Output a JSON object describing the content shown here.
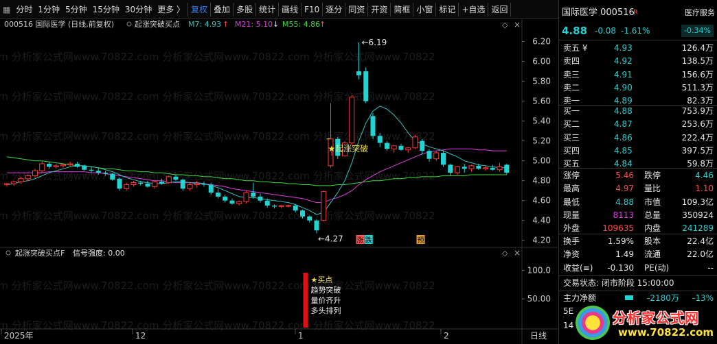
{
  "toolbar": {
    "periods": [
      "分时",
      "1分钟",
      "5分钟",
      "15分钟",
      "30分钟",
      "更多 〉"
    ],
    "tools": [
      "复权",
      "叠加",
      "多股",
      "统计",
      "画线",
      "F10",
      "逐分",
      "同资",
      "开资",
      "简框",
      "小窗",
      "标记",
      "+自选",
      "返回"
    ]
  },
  "chart": {
    "header": {
      "code": "000516",
      "name": "国际医学",
      "mode": "(日线,前复权)",
      "indicator": "起涨突破买点",
      "ma7": "M7: 4.93",
      "ma21": "M21: 5.10",
      "ma55": "M55: 4.86"
    },
    "price_ticks": [
      "6.20",
      "6.00",
      "5.80",
      "5.60",
      "5.40",
      "5.20",
      "5.00",
      "4.80",
      "4.60",
      "4.40",
      "4.20"
    ],
    "high_label": "6.19",
    "low_label": "4.27",
    "signal_label": "★起涨突破",
    "tag_zhangdie_1": "涨",
    "tag_zhangdie_2": "跌",
    "tag_yu": "预",
    "sub_header": {
      "name": "起涨突破买点F",
      "signal": "信号强度: 0.00"
    },
    "sub_ticks": [
      "100.0",
      "50.00"
    ],
    "buy_box": [
      "★买点",
      "趋势突破",
      "量价齐升",
      "多头排列"
    ],
    "date_labels": [
      "2025年",
      "12",
      "1",
      "2"
    ],
    "period_label": "日线",
    "watermark": "com 分析家公式网www.70822.com 分析家公式网www.70822.com 分析家公式网www.70822"
  },
  "chart_data": {
    "type": "candlestick",
    "title": "国际医学 000516 日线",
    "ylim": [
      4.15,
      6.3
    ],
    "candles": [
      [
        4.76,
        4.78,
        4.74,
        4.77
      ],
      [
        4.77,
        4.8,
        4.75,
        4.79
      ],
      [
        4.79,
        4.84,
        4.77,
        4.82
      ],
      [
        4.82,
        4.86,
        4.8,
        4.85
      ],
      [
        4.85,
        4.92,
        4.83,
        4.9
      ],
      [
        4.9,
        5.0,
        4.88,
        4.97
      ],
      [
        4.97,
        4.99,
        4.92,
        4.94
      ],
      [
        4.94,
        4.97,
        4.92,
        4.95
      ],
      [
        4.95,
        4.97,
        4.93,
        4.96
      ],
      [
        4.96,
        4.99,
        4.94,
        4.97
      ],
      [
        4.97,
        4.99,
        4.93,
        4.94
      ],
      [
        4.95,
        4.96,
        4.9,
        4.91
      ],
      [
        4.91,
        4.94,
        4.88,
        4.9
      ],
      [
        4.9,
        4.93,
        4.86,
        4.88
      ],
      [
        4.88,
        4.9,
        4.85,
        4.87
      ],
      [
        4.87,
        4.88,
        4.8,
        4.81
      ],
      [
        4.82,
        4.83,
        4.7,
        4.72
      ],
      [
        4.72,
        4.78,
        4.7,
        4.76
      ],
      [
        4.76,
        4.8,
        4.74,
        4.78
      ],
      [
        4.78,
        4.8,
        4.75,
        4.77
      ],
      [
        4.77,
        4.8,
        4.73,
        4.74
      ],
      [
        4.74,
        4.8,
        4.72,
        4.79
      ],
      [
        4.79,
        4.82,
        4.76,
        4.77
      ],
      [
        4.78,
        4.85,
        4.77,
        4.84
      ],
      [
        4.84,
        4.86,
        4.8,
        4.81
      ],
      [
        4.81,
        4.82,
        4.7,
        4.72
      ],
      [
        4.72,
        4.78,
        4.7,
        4.76
      ],
      [
        4.76,
        4.8,
        4.73,
        4.77
      ],
      [
        4.77,
        4.79,
        4.74,
        4.76
      ],
      [
        4.76,
        4.78,
        4.66,
        4.68
      ],
      [
        4.68,
        4.72,
        4.62,
        4.64
      ],
      [
        4.64,
        4.66,
        4.58,
        4.6
      ],
      [
        4.6,
        4.62,
        4.56,
        4.57
      ],
      [
        4.57,
        4.6,
        4.55,
        4.59
      ],
      [
        4.59,
        4.7,
        4.57,
        4.68
      ],
      [
        4.68,
        4.78,
        4.62,
        4.64
      ],
      [
        4.64,
        4.67,
        4.58,
        4.6
      ],
      [
        4.6,
        4.62,
        4.53,
        4.55
      ],
      [
        4.55,
        4.56,
        4.52,
        4.54
      ],
      [
        4.54,
        4.56,
        4.52,
        4.55
      ],
      [
        4.55,
        4.56,
        4.53,
        4.55
      ],
      [
        4.55,
        4.56,
        4.48,
        4.5
      ],
      [
        4.5,
        4.51,
        4.42,
        4.44
      ],
      [
        4.44,
        4.45,
        4.38,
        4.4
      ],
      [
        4.4,
        4.41,
        4.27,
        4.3
      ],
      [
        4.4,
        4.7,
        4.39,
        4.69
      ],
      [
        4.95,
        5.58,
        4.93,
        5.22
      ],
      [
        5.22,
        5.24,
        5.02,
        5.05
      ],
      [
        5.05,
        5.2,
        5.04,
        5.18
      ],
      [
        5.18,
        5.66,
        5.16,
        5.64
      ],
      [
        5.9,
        6.19,
        5.82,
        5.86
      ],
      [
        5.9,
        5.94,
        5.58,
        5.6
      ],
      [
        5.45,
        5.48,
        5.22,
        5.25
      ],
      [
        5.25,
        5.28,
        5.14,
        5.18
      ],
      [
        5.18,
        5.2,
        5.1,
        5.12
      ],
      [
        5.12,
        5.16,
        5.08,
        5.15
      ],
      [
        5.15,
        5.17,
        5.1,
        5.11
      ],
      [
        5.11,
        5.14,
        5.08,
        5.13
      ],
      [
        5.13,
        5.26,
        5.12,
        5.24
      ],
      [
        5.2,
        5.22,
        5.06,
        5.1
      ],
      [
        5.1,
        5.12,
        4.99,
        5.02
      ],
      [
        5.02,
        5.1,
        5.0,
        5.08
      ],
      [
        5.08,
        5.1,
        4.94,
        4.96
      ],
      [
        4.96,
        4.97,
        4.85,
        4.88
      ],
      [
        4.88,
        4.95,
        4.86,
        4.94
      ],
      [
        4.94,
        4.97,
        4.88,
        4.92
      ],
      [
        4.92,
        4.96,
        4.89,
        4.95
      ],
      [
        4.95,
        4.97,
        4.91,
        4.92
      ],
      [
        4.92,
        4.95,
        4.9,
        4.93
      ],
      [
        4.93,
        4.96,
        4.9,
        4.91
      ],
      [
        4.91,
        4.98,
        4.89,
        4.94
      ],
      [
        4.96,
        4.97,
        4.86,
        4.88
      ]
    ],
    "ma7": [
      4.76,
      4.77,
      4.79,
      4.8,
      4.82,
      4.85,
      4.88,
      4.9,
      4.92,
      4.94,
      4.95,
      4.95,
      4.94,
      4.93,
      4.91,
      4.89,
      4.86,
      4.83,
      4.81,
      4.79,
      4.78,
      4.77,
      4.77,
      4.78,
      4.79,
      4.79,
      4.78,
      4.78,
      4.77,
      4.75,
      4.73,
      4.7,
      4.67,
      4.64,
      4.63,
      4.63,
      4.62,
      4.61,
      4.6,
      4.59,
      4.58,
      4.56,
      4.53,
      4.5,
      4.46,
      4.48,
      4.58,
      4.68,
      4.8,
      4.98,
      5.2,
      5.38,
      5.5,
      5.55,
      5.52,
      5.46,
      5.38,
      5.28,
      5.2,
      5.17,
      5.14,
      5.12,
      5.1,
      5.07,
      5.04,
      5.0,
      4.98,
      4.96,
      4.95,
      4.94,
      4.93,
      4.93
    ],
    "ma21": [
      4.88,
      4.88,
      4.88,
      4.88,
      4.88,
      4.88,
      4.89,
      4.89,
      4.89,
      4.89,
      4.89,
      4.89,
      4.88,
      4.88,
      4.87,
      4.86,
      4.85,
      4.84,
      4.83,
      4.82,
      4.81,
      4.8,
      4.8,
      4.79,
      4.78,
      4.78,
      4.78,
      4.77,
      4.77,
      4.76,
      4.75,
      4.74,
      4.72,
      4.71,
      4.7,
      4.69,
      4.68,
      4.67,
      4.66,
      4.65,
      4.64,
      4.63,
      4.62,
      4.6,
      4.58,
      4.58,
      4.61,
      4.63,
      4.66,
      4.7,
      4.76,
      4.81,
      4.85,
      4.89,
      4.92,
      4.95,
      4.98,
      5.01,
      5.04,
      5.07,
      5.09,
      5.1,
      5.11,
      5.12,
      5.12,
      5.12,
      5.12,
      5.11,
      5.11,
      5.1,
      5.1,
      5.1
    ],
    "ma55": [
      5.04,
      5.03,
      5.02,
      5.01,
      5.0,
      5.0,
      4.99,
      4.98,
      4.97,
      4.96,
      4.95,
      4.95,
      4.94,
      4.93,
      4.92,
      4.92,
      4.91,
      4.9,
      4.9,
      4.89,
      4.89,
      4.88,
      4.88,
      4.87,
      4.86,
      4.86,
      4.85,
      4.85,
      4.84,
      4.84,
      4.83,
      4.82,
      4.82,
      4.81,
      4.8,
      4.8,
      4.79,
      4.79,
      4.78,
      4.78,
      4.77,
      4.77,
      4.76,
      4.76,
      4.75,
      4.75,
      4.75,
      4.76,
      4.76,
      4.77,
      4.78,
      4.79,
      4.8,
      4.8,
      4.81,
      4.82,
      4.82,
      4.83,
      4.83,
      4.84,
      4.84,
      4.84,
      4.85,
      4.85,
      4.85,
      4.85,
      4.86,
      4.86,
      4.86,
      4.86,
      4.86,
      4.86
    ]
  },
  "panel": {
    "name": "国际医学",
    "code": "000516",
    "r_badge": "R",
    "sector": "医疗服务",
    "price": "4.88",
    "change": "-0.08",
    "pct": "-1.61%",
    "sector_pct": "-0.34%",
    "asks": [
      {
        "label": "卖五 ¥",
        "price": "4.93",
        "vol": "126.4万"
      },
      {
        "label": "卖四",
        "price": "4.92",
        "vol": "138.5万"
      },
      {
        "label": "卖三",
        "price": "4.91",
        "vol": "156.6万"
      },
      {
        "label": "卖二",
        "price": "4.90",
        "vol": "511.3万"
      },
      {
        "label": "卖一",
        "price": "4.89",
        "vol": "82.3万"
      }
    ],
    "bids": [
      {
        "label": "买一",
        "price": "4.88",
        "vol": "753.9万"
      },
      {
        "label": "买二",
        "price": "4.87",
        "vol": "253.6万"
      },
      {
        "label": "买三",
        "price": "4.86",
        "vol": "222.4万"
      },
      {
        "label": "买四",
        "price": "4.85",
        "vol": "397.5万"
      },
      {
        "label": "买五",
        "price": "4.84",
        "vol": "59.8万"
      }
    ],
    "stats": [
      {
        "l1": "涨停",
        "v1": "5.46",
        "l2": "跌停",
        "v2": "4.46"
      },
      {
        "l1": "最高",
        "v1": "4.97",
        "l2": "量比",
        "v2": "1.10"
      },
      {
        "l1": "最低",
        "v1": "4.88",
        "l2": "市值",
        "v2": "109.3亿"
      },
      {
        "l1": "现量",
        "v1": "8113",
        "l2": "总量",
        "v2": "350924"
      },
      {
        "l1": "外盘",
        "v1": "109635",
        "l2": "内盘",
        "v2": "241289"
      }
    ],
    "stats2": [
      {
        "l1": "换手",
        "v1": "1.59%",
        "l2": "股本",
        "v2": "22.4亿"
      },
      {
        "l1": "净资",
        "v1": "1.49",
        "l2": "流通",
        "v2": "22.0亿"
      },
      {
        "l1": "收益(≡)",
        "v1": "-0.130",
        "l2": "PE(动)",
        "v2": "--"
      }
    ],
    "trade_status": "交易状态: 闭市阶段 15:00:00",
    "flow_label": "主力净额",
    "flow_value": "-2180万",
    "flow_pct": "-13%",
    "bottom_row1": "5E",
    "bottom_row2": "14",
    "logo_cn": "分析家公式网",
    "logo_url": "www.70822.com"
  }
}
